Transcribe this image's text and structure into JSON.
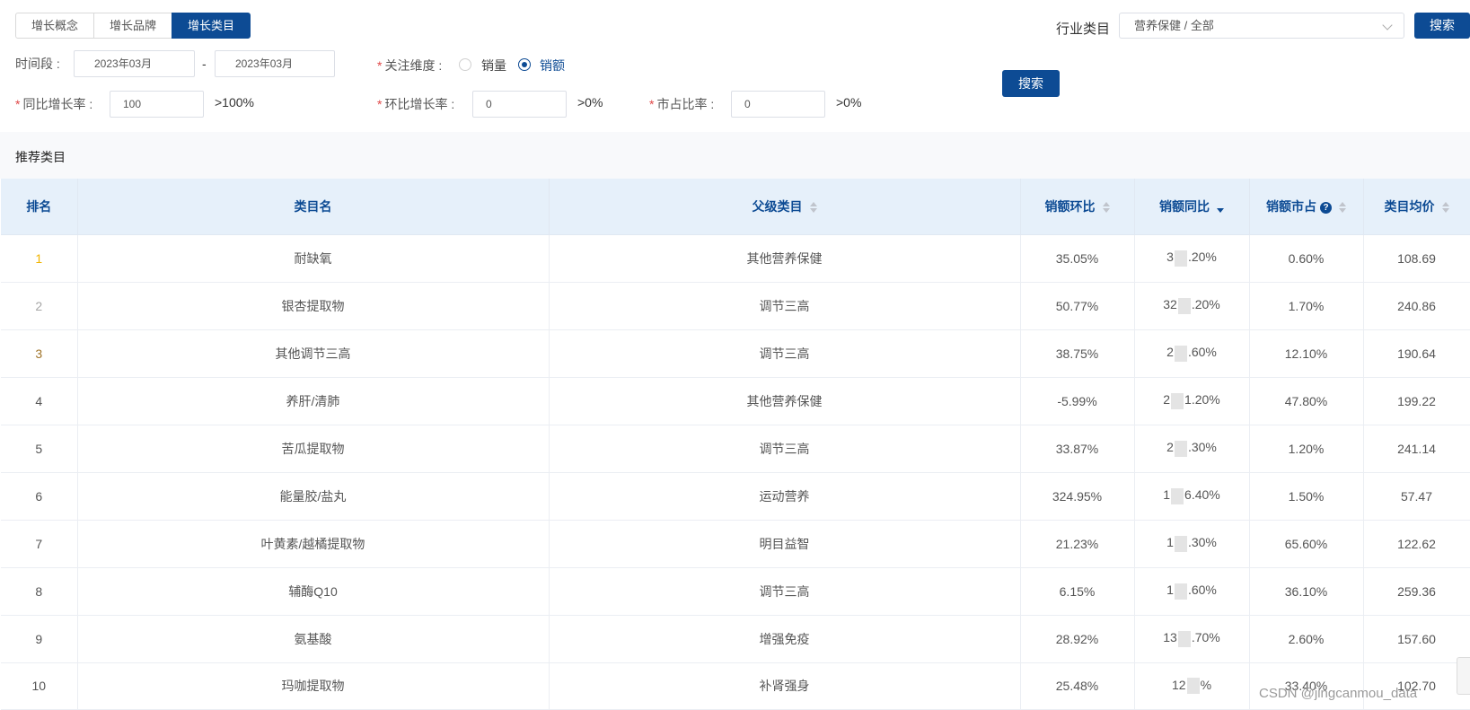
{
  "tabs": [
    {
      "label": "增长概念",
      "active": false
    },
    {
      "label": "增长品牌",
      "active": false
    },
    {
      "label": "增长类目",
      "active": true
    }
  ],
  "industry": {
    "label": "行业类目",
    "value": "营养保健 / 全部",
    "search_label": "搜索"
  },
  "filters": {
    "period_label": "时间段 :",
    "period_start": "2023年03月",
    "period_sep": "-",
    "period_end": "2023年03月",
    "dimension_label": "关注维度 :",
    "dimension_options": [
      {
        "label": "销量",
        "checked": false
      },
      {
        "label": "销额",
        "checked": true
      }
    ],
    "yoy_label": "同比增长率 :",
    "yoy_value": "100",
    "yoy_suffix": ">100%",
    "mom_label": "环比增长率 :",
    "mom_value": "0",
    "mom_suffix": ">0%",
    "share_label": "市占比率 :",
    "share_value": "0",
    "share_suffix": ">0%",
    "search_label": "搜索"
  },
  "section_title": "推荐类目",
  "table": {
    "headers": {
      "rank": "排名",
      "name": "类目名",
      "parent": "父级类目",
      "mom": "销额环比",
      "yoy": "销额同比",
      "share": "销额市占",
      "avg": "类目均价"
    },
    "rows": [
      {
        "rank": "1",
        "name": "耐缺氧",
        "parent": "其他营养保健",
        "mom": "35.05%",
        "yoy_a": "3",
        "yoy_b": ".20%",
        "share": "0.60%",
        "avg": "108.69"
      },
      {
        "rank": "2",
        "name": "银杏提取物",
        "parent": "调节三高",
        "mom": "50.77%",
        "yoy_a": "32",
        "yoy_b": ".20%",
        "share": "1.70%",
        "avg": "240.86"
      },
      {
        "rank": "3",
        "name": "其他调节三高",
        "parent": "调节三高",
        "mom": "38.75%",
        "yoy_a": "2",
        "yoy_b": ".60%",
        "share": "12.10%",
        "avg": "190.64"
      },
      {
        "rank": "4",
        "name": "养肝/清肺",
        "parent": "其他营养保健",
        "mom": "-5.99%",
        "yoy_a": "2",
        "yoy_b": "1.20%",
        "share": "47.80%",
        "avg": "199.22"
      },
      {
        "rank": "5",
        "name": "苦瓜提取物",
        "parent": "调节三高",
        "mom": "33.87%",
        "yoy_a": "2",
        "yoy_b": ".30%",
        "share": "1.20%",
        "avg": "241.14"
      },
      {
        "rank": "6",
        "name": "能量胶/盐丸",
        "parent": "运动营养",
        "mom": "324.95%",
        "yoy_a": "1",
        "yoy_b": "6.40%",
        "share": "1.50%",
        "avg": "57.47"
      },
      {
        "rank": "7",
        "name": "叶黄素/越橘提取物",
        "parent": "明目益智",
        "mom": "21.23%",
        "yoy_a": "1",
        "yoy_b": ".30%",
        "share": "65.60%",
        "avg": "122.62"
      },
      {
        "rank": "8",
        "name": "辅酶Q10",
        "parent": "调节三高",
        "mom": "6.15%",
        "yoy_a": "1",
        "yoy_b": ".60%",
        "share": "36.10%",
        "avg": "259.36"
      },
      {
        "rank": "9",
        "name": "氨基酸",
        "parent": "增强免疫",
        "mom": "28.92%",
        "yoy_a": "13",
        "yoy_b": ".70%",
        "share": "2.60%",
        "avg": "157.60"
      },
      {
        "rank": "10",
        "name": "玛咖提取物",
        "parent": "补肾强身",
        "mom": "25.48%",
        "yoy_a": "12",
        "yoy_b": "%",
        "share": "33.40%",
        "avg": "102.70"
      }
    ]
  },
  "watermark": "CSDN @jingcanmou_data",
  "colors": {
    "primary": "#0d4b94",
    "header_bg": "#e6f0fa",
    "gold": "#f0b400",
    "silver": "#a6a6a6",
    "bronze": "#a0742a"
  }
}
